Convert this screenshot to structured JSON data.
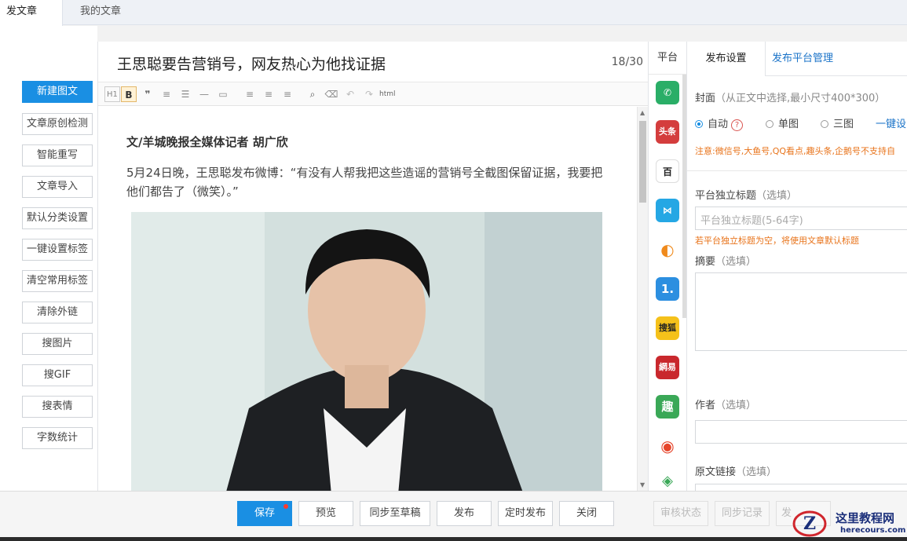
{
  "top_tabs": [
    "发文章",
    "我的文章"
  ],
  "sidebar": {
    "buttons": [
      "新建图文",
      "文章原创检测",
      "智能重写",
      "文章导入",
      "默认分类设置",
      "一键设置标签",
      "清空常用标签",
      "清除外链",
      "搜图片",
      "搜GIF",
      "搜表情",
      "字数统计"
    ]
  },
  "editor": {
    "title": "王思聪要告营销号，网友热心为他找证据",
    "title_count": "18/30",
    "toolbar": {
      "heading": "H1",
      "bold": "B",
      "quote": "❞",
      "ordered_list": "≡",
      "unordered_list": "☰",
      "hr": "—",
      "image": "▭",
      "align_left": "≡",
      "align_center": "≡",
      "align_right": "≡",
      "find": "⌕",
      "clear": "⌫",
      "undo": "↶",
      "redo": "↷",
      "html": "html"
    },
    "byline": "文/羊城晚报全媒体记者 胡广欣",
    "paragraph": "5月24日晚，王思聪发布微博：“有没有人帮我把这些造谣的营销号全截图保留证据，我要把他们都告了（微笑）。”"
  },
  "platforms": {
    "header": "平台",
    "items": [
      {
        "name": "wechat",
        "glyph": "✆",
        "color": "#2aae67"
      },
      {
        "name": "toutiao",
        "glyph": "头条",
        "color": "#d43d3d"
      },
      {
        "name": "baijia",
        "glyph": "百",
        "color": "#ffffff"
      },
      {
        "name": "dayu",
        "glyph": "⋈",
        "color": "#25a7e4"
      },
      {
        "name": "qq-kandian",
        "glyph": "◐",
        "color": "#f08a1c"
      },
      {
        "name": "yidian",
        "glyph": "1.",
        "color": "#2c8fe0"
      },
      {
        "name": "sohu",
        "glyph": "搜狐",
        "color": "#f5c11a"
      },
      {
        "name": "netease",
        "glyph": "網易",
        "color": "#c9282d"
      },
      {
        "name": "qutoutiao",
        "glyph": "趣",
        "color": "#3aa857"
      },
      {
        "name": "weibo",
        "glyph": "◉",
        "color": "#e6452b"
      },
      {
        "name": "qiehao",
        "glyph": "◈",
        "color": "#3aa857"
      }
    ]
  },
  "settings": {
    "tabs": [
      "发布设置",
      "发布平台管理"
    ],
    "cover_label": "封面",
    "cover_hint": "（从正文中选择,最小尺寸400*300）",
    "cover_options": [
      "自动",
      "单图",
      "三图"
    ],
    "cover_help": "?",
    "one_click_link": "一键设",
    "warning": "注意:微信号,大鱼号,QQ看点,趣头条,企鹅号不支持自",
    "standalone_title_label": "平台独立标题",
    "standalone_title_hint": "（选填）",
    "standalone_title_placeholder": "平台独立标题(5-64字)",
    "standalone_title_note": "若平台独立标题为空，将使用文章默认标题",
    "summary_label": "摘要",
    "summary_hint": "（选填）",
    "author_label": "作者",
    "author_hint": "（选填）",
    "source_link_label": "原文链接",
    "source_link_hint": "（选填）"
  },
  "bottom_bar": {
    "buttons": [
      "保存",
      "预览",
      "同步至草稿",
      "发布",
      "定时发布",
      "关闭"
    ],
    "disabled_buttons": [
      "审核状态",
      "同步记录",
      "发"
    ]
  },
  "watermark": {
    "cn": "这里教程网",
    "url": "herecours.com"
  }
}
